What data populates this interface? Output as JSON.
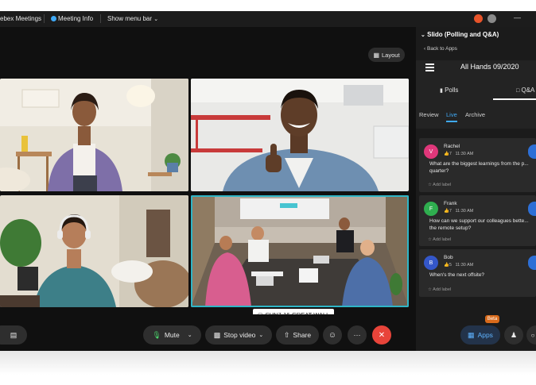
{
  "titlebar": {
    "app_name": "ebex Meetings",
    "meeting_info": "Meeting Info",
    "show_menu_bar": "Show menu bar",
    "minimize_glyph": "—"
  },
  "stage": {
    "layout_label": "Layout",
    "room_label": "SHN7-16-GREAT WALL"
  },
  "panel": {
    "title": "Slido (Polling and Q&A)",
    "back": "Back to Apps",
    "event_title": "All Hands 09/2020",
    "tabs": [
      "Polls",
      "Q&A"
    ],
    "subtabs": [
      "Review",
      "Live",
      "Archive"
    ],
    "questions": [
      {
        "initial": "V",
        "name": "Rachel",
        "votes": "7",
        "time": "11:30 AM",
        "text": "What are the biggest learnings from the p... quarter?",
        "label": "Add label",
        "color": "#e0377a"
      },
      {
        "initial": "F",
        "name": "Frank",
        "votes": "7",
        "time": "11:30 AM",
        "text": "How can we support our colleagues bette... the remote setup?",
        "label": "Add label",
        "color": "#2fae4f"
      },
      {
        "initial": "B",
        "name": "Bob",
        "votes": "5",
        "time": "11:30 AM",
        "text": "When's the next offsite?",
        "label": "Add label",
        "color": "#3457c9"
      }
    ]
  },
  "toolbar": {
    "mute": "Mute",
    "stop_video": "Stop video",
    "share": "Share",
    "apps": "Apps",
    "beta": "Beta",
    "more": "···"
  },
  "colors": {
    "accent_blue": "#3fa9f5",
    "end_call_red": "#e8443a",
    "active_tile_outline": "#2fb5c6",
    "beta_orange": "#d86a1b"
  }
}
